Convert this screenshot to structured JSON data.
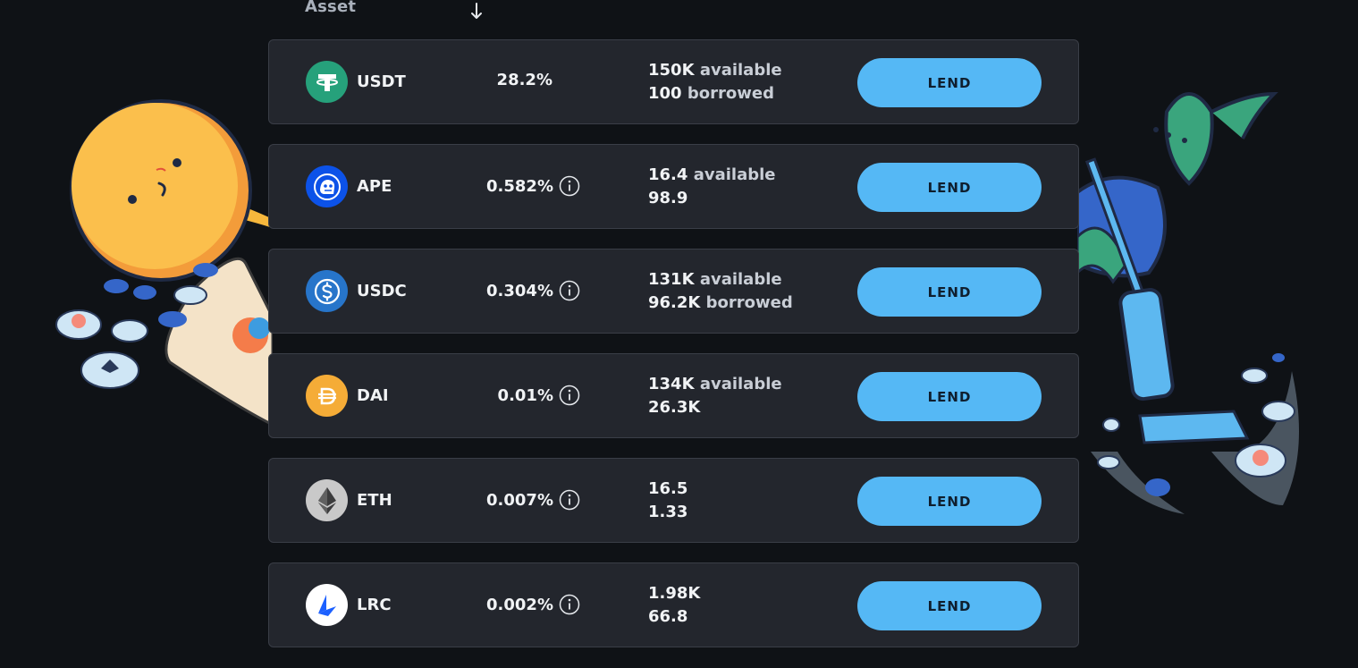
{
  "header": {
    "column_asset": "Asset",
    "sort_icon": "arrow-down-icon"
  },
  "assets": [
    {
      "symbol": "USDT",
      "rate": "28.2%",
      "info": false,
      "available": "150K",
      "available_suffix": "available",
      "borrowed": "100",
      "borrowed_suffix": "borrowed",
      "icon": "tether-icon",
      "color": "#26a17b",
      "button": "LEND"
    },
    {
      "symbol": "APE",
      "rate": "0.582%",
      "info": true,
      "available": "16.4",
      "available_suffix": "available",
      "borrowed": "98.9",
      "borrowed_suffix": "",
      "icon": "apecoin-icon",
      "color": "#0c52e8",
      "button": "LEND"
    },
    {
      "symbol": "USDC",
      "rate": "0.304%",
      "info": true,
      "available": "131K",
      "available_suffix": "available",
      "borrowed": "96.2K",
      "borrowed_suffix": "borrowed",
      "icon": "usdc-icon",
      "color": "#2775ca",
      "button": "LEND"
    },
    {
      "symbol": "DAI",
      "rate": "0.01%",
      "info": true,
      "available": "134K",
      "available_suffix": "available",
      "borrowed": "26.3K",
      "borrowed_suffix": "",
      "icon": "dai-icon",
      "color": "#f5ac37",
      "button": "LEND"
    },
    {
      "symbol": "ETH",
      "rate": "0.007%",
      "info": true,
      "available": "16.5",
      "available_suffix": "",
      "borrowed": "1.33",
      "borrowed_suffix": "",
      "icon": "ethereum-icon",
      "color": "#c9c9c9",
      "button": "LEND"
    },
    {
      "symbol": "LRC",
      "rate": "0.002%",
      "info": true,
      "available": "1.98K",
      "available_suffix": "",
      "borrowed": "66.8",
      "borrowed_suffix": "",
      "icon": "loopring-icon",
      "color": "#ffffff",
      "button": "LEND"
    }
  ],
  "colors": {
    "background": "#0f1216",
    "row_background": "#23262d",
    "row_border": "#3a3e47",
    "button": "#55b8f5",
    "button_text": "#0f1e2e"
  }
}
